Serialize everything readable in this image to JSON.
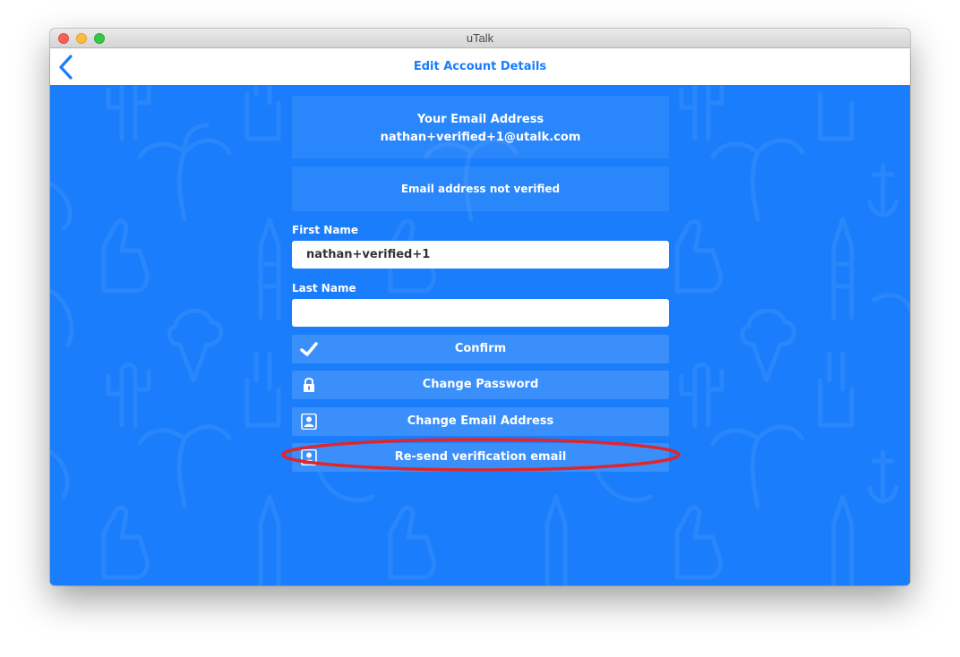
{
  "window": {
    "title": "uTalk"
  },
  "navbar": {
    "title": "Edit Account Details",
    "back_icon": "chevron-left-icon"
  },
  "email_panel": {
    "heading": "Your Email Address",
    "address": "nathan+verified+1@utalk.com"
  },
  "verification": {
    "status": "Email address not verified"
  },
  "form": {
    "first_name": {
      "label": "First Name",
      "value": "nathan+verified+1",
      "placeholder": ""
    },
    "last_name": {
      "label": "Last Name",
      "value": "",
      "placeholder": ""
    }
  },
  "buttons": {
    "confirm": {
      "label": "Confirm",
      "icon": "checkmark-icon"
    },
    "change_password": {
      "label": "Change Password",
      "icon": "lock-icon"
    },
    "change_email": {
      "label": "Change Email Address",
      "icon": "contact-card-icon"
    },
    "resend_verification": {
      "label": "Re-send verification email",
      "icon": "contact-card-icon"
    }
  },
  "colors": {
    "background": "#1a7dfb",
    "accent": "#1a7dfb",
    "button": "#3a8ffb",
    "highlight_ring": "#e0262a"
  }
}
